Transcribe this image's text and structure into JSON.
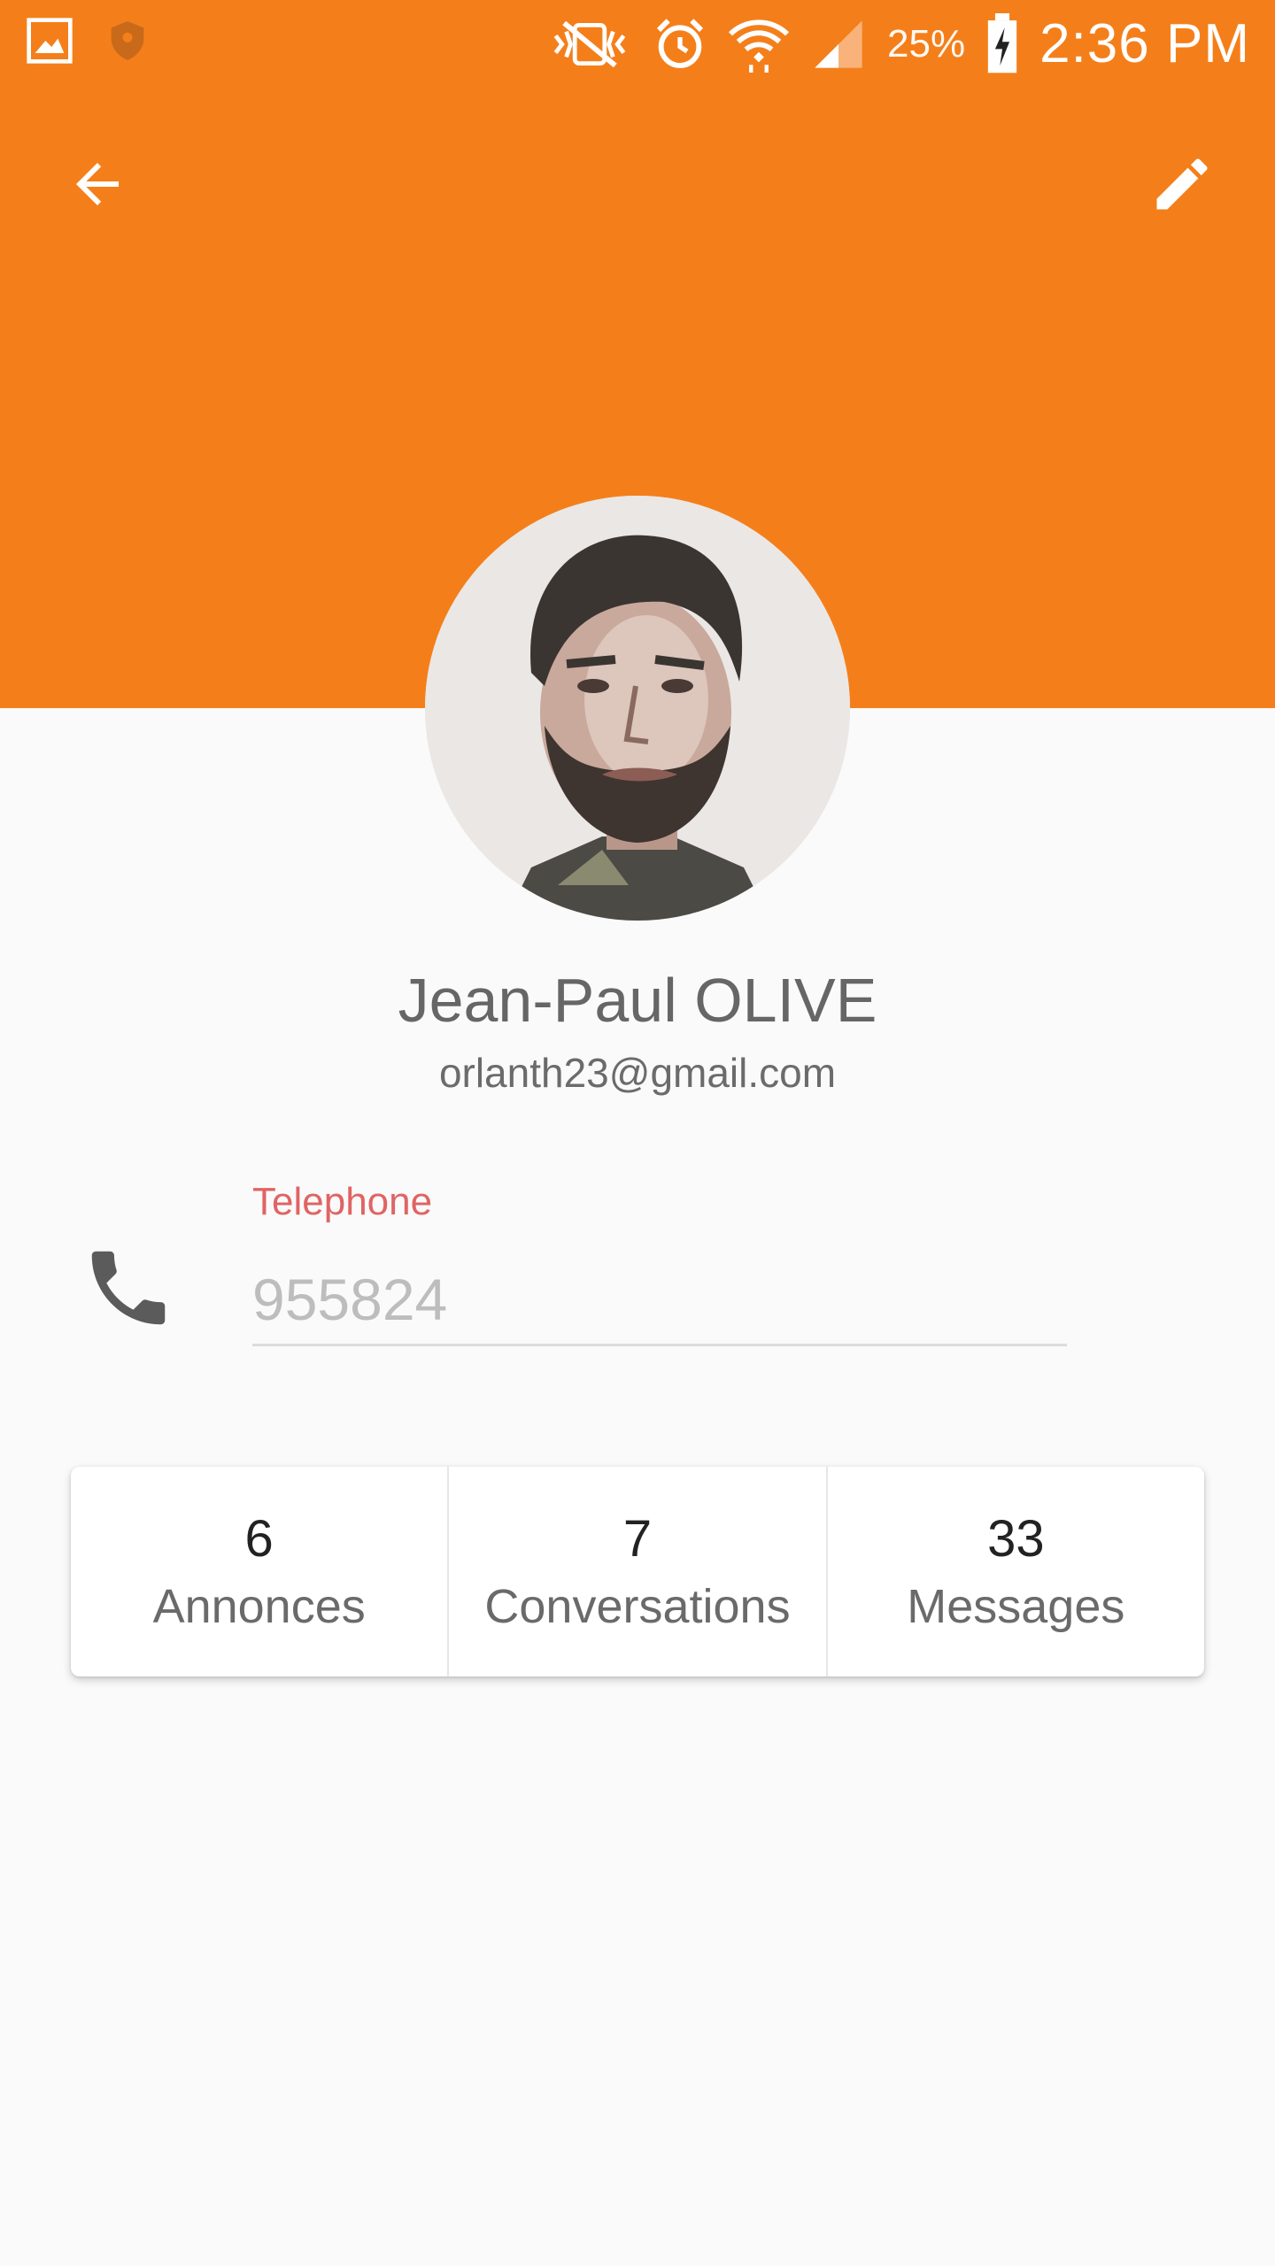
{
  "colors": {
    "primary": "#f47f1a",
    "label_accent": "#e06464",
    "background": "#fafafa"
  },
  "status_bar": {
    "battery_percent": "25%",
    "time": "2:36 PM",
    "icons": [
      "gallery-icon",
      "shield-icon",
      "vibrate-mute-icon",
      "alarm-icon",
      "wifi-icon",
      "signal-icon",
      "battery-charging-icon"
    ]
  },
  "toolbar": {
    "back_icon": "arrow-back-icon",
    "edit_icon": "pencil-icon"
  },
  "profile": {
    "name": "Jean-Paul OLIVE",
    "email": "orlanth23@gmail.com"
  },
  "telephone": {
    "label": "Telephone",
    "placeholder": "955824",
    "icon": "phone-icon"
  },
  "stats": [
    {
      "value": "6",
      "label": "Annonces"
    },
    {
      "value": "7",
      "label": "Conversations"
    },
    {
      "value": "33",
      "label": "Messages"
    }
  ]
}
